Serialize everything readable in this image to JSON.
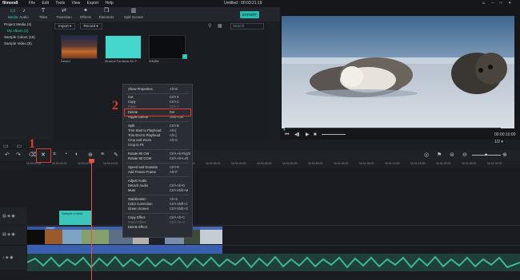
{
  "app": {
    "logo": "filmora9",
    "title": "Untitled : 00:03:21:19",
    "menu": [
      "File",
      "Edit",
      "Tools",
      "View",
      "Export",
      "Help"
    ]
  },
  "tabs": [
    {
      "label": "Media",
      "icon": "folder-icon"
    },
    {
      "label": "Audio",
      "icon": "music-note-icon"
    },
    {
      "label": "Titles",
      "icon": "text-icon"
    },
    {
      "label": "Transition",
      "icon": "transition-icon"
    },
    {
      "label": "Effects",
      "icon": "effects-icon"
    },
    {
      "label": "Elements",
      "icon": "elements-icon"
    },
    {
      "label": "Split Screen",
      "icon": "split-screen-icon"
    }
  ],
  "export_label": "EXPORT",
  "sidebar": {
    "items": [
      "Project Media (4)",
      "My Album (2)",
      "Sample Colors (15)",
      "Sample Video (8)"
    ]
  },
  "media": {
    "import_label": "Import",
    "record_label": "Record",
    "search_placeholder": "Search",
    "clips": [
      {
        "label": "Desert"
      },
      {
        "label": "Musical Fantasia 9th F..."
      },
      {
        "label": "Wildlife"
      }
    ]
  },
  "preview": {
    "timecode": "00:00:10:00",
    "time_dropdown": "1/2"
  },
  "context_menu": {
    "items": [
      {
        "label": "Show Properties",
        "shortcut": "Alt+E",
        "enabled": true
      },
      {
        "label": "Cut",
        "shortcut": "Ctrl+X",
        "enabled": true
      },
      {
        "label": "Copy",
        "shortcut": "Ctrl+C",
        "enabled": true
      },
      {
        "label": "Paste",
        "shortcut": "Ctrl+V",
        "enabled": false
      },
      {
        "label": "Delete",
        "shortcut": "Del",
        "enabled": true
      },
      {
        "label": "Ripple Delete",
        "shortcut": "Shift+Del",
        "enabled": true
      },
      {
        "label": "Split",
        "shortcut": "Ctrl+B",
        "enabled": true
      },
      {
        "label": "Trim Start to Playhead",
        "shortcut": "Alt+[",
        "enabled": true
      },
      {
        "label": "Trim End to Playhead",
        "shortcut": "Alt+]",
        "enabled": true
      },
      {
        "label": "Crop and Zoom",
        "shortcut": "Alt+C",
        "enabled": true
      },
      {
        "label": "Crop to Fit",
        "shortcut": "",
        "enabled": true
      },
      {
        "label": "Rotate 90 CW",
        "shortcut": "Ctrl+Alt+Right",
        "enabled": true
      },
      {
        "label": "Rotate 90 CCW",
        "shortcut": "Ctrl+Alt+Left",
        "enabled": true
      },
      {
        "label": "Speed and Duration",
        "shortcut": "Ctrl+R",
        "enabled": true
      },
      {
        "label": "Add Freeze Frame",
        "shortcut": "Alt+F",
        "enabled": true
      },
      {
        "label": "Adjust Audio",
        "shortcut": "",
        "enabled": true
      },
      {
        "label": "Detach Audio",
        "shortcut": "Ctrl+Alt+D",
        "enabled": true
      },
      {
        "label": "Mute",
        "shortcut": "Ctrl+Shift+M",
        "enabled": true
      },
      {
        "label": "Stabilization",
        "shortcut": "Alt+S",
        "enabled": true
      },
      {
        "label": "Color Correction",
        "shortcut": "Ctrl+Shift+C",
        "enabled": true
      },
      {
        "label": "Green Screen",
        "shortcut": "Ctrl+Shift+G",
        "enabled": true
      },
      {
        "label": "Copy Effect",
        "shortcut": "Ctrl+Alt+C",
        "enabled": true
      },
      {
        "label": "Paste Effect",
        "shortcut": "Ctrl+Alt+V",
        "enabled": false
      },
      {
        "label": "Delete Effect",
        "shortcut": "",
        "enabled": true
      }
    ]
  },
  "timeline": {
    "ruler_labels": [
      "00:00:00:00",
      "00:00:05:00",
      "00:00:10:00",
      "00:00:15:00",
      "00:00:20:00",
      "00:00:25:00",
      "00:00:30:00",
      "00:00:35:00",
      "00:00:40:00",
      "00:00:45:00",
      "00:00:50:00",
      "00:00:55:00",
      "00:01:00:00",
      "00:01:05:00",
      "00:01:10:00",
      "00:01:15:00",
      "00:01:20:00",
      "00:01:25:00",
      "00:01:30:00"
    ],
    "clips": [
      {
        "label": "Sample Colors"
      },
      {
        "label": "Desert"
      },
      {
        "label": "Wildlife"
      }
    ]
  },
  "annotations": {
    "step1": "1",
    "step2": "2"
  },
  "colors": {
    "accent": "#2bd1c4",
    "highlight": "#e23b2e",
    "playhead": "#e8513d",
    "audio_wave": "#3fb59c"
  }
}
